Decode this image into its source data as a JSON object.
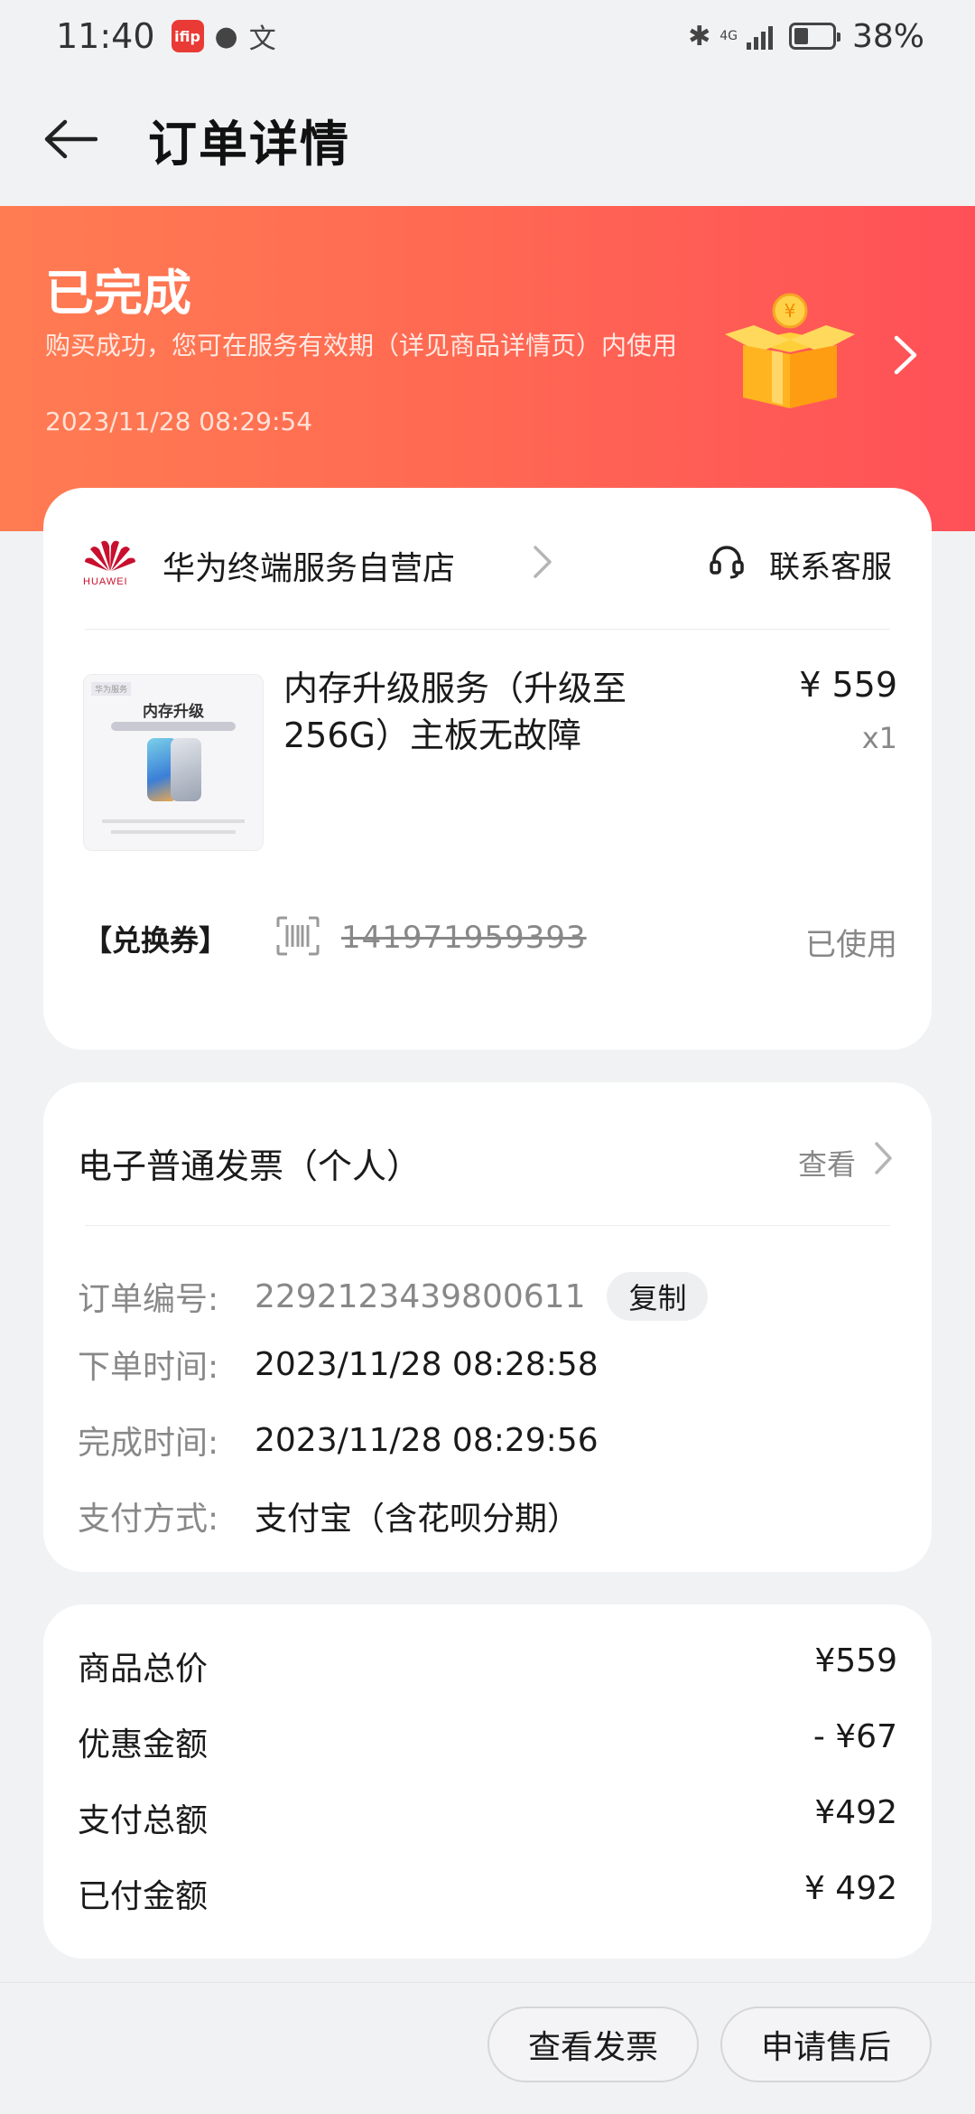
{
  "status_bar": {
    "time": "11:40",
    "app_badge": "ifip",
    "network": "4G",
    "battery_percent": "38%",
    "battery_level": 0.38
  },
  "header": {
    "title": "订单详情"
  },
  "banner": {
    "status": "已完成",
    "description": "购买成功，您可在服务有效期（详见商品详情页）内使用",
    "time": "2023/11/28 08:29:54",
    "gift_coin_symbol": "¥",
    "colors": {
      "start": "#ff7c52",
      "end": "#ff5058"
    }
  },
  "store": {
    "logo_text": "HUAWEI",
    "name": "华为终端服务自营店",
    "customer_service_label": "联系客服"
  },
  "product": {
    "image_tag": "华为服务",
    "image_title": "内存升级",
    "name": "内存升级服务（升级至256G）主板无故障",
    "price": "¥ 559",
    "quantity": "x1"
  },
  "voucher": {
    "label": "【兑换券】",
    "code": "141971959393",
    "status": "已使用"
  },
  "invoice": {
    "title": "电子普通发票（个人）",
    "view_label": "查看"
  },
  "order_info": {
    "order_no_label": "订单编号:",
    "order_no": "2292123439800611",
    "copy_label": "复制",
    "order_time_label": "下单时间:",
    "order_time": "2023/11/28 08:28:58",
    "complete_time_label": "完成时间:",
    "complete_time": "2023/11/28 08:29:56",
    "payment_label": "支付方式:",
    "payment": "支付宝（含花呗分期）"
  },
  "price_summary": {
    "rows": [
      {
        "label": "商品总价",
        "value": "¥559"
      },
      {
        "label": "优惠金额",
        "value": "- ¥67"
      },
      {
        "label": "支付总额",
        "value": "¥492"
      },
      {
        "label": "已付金额",
        "value": "¥ 492"
      }
    ]
  },
  "bottom_bar": {
    "view_invoice_label": "查看发票",
    "after_sale_label": "申请售后"
  }
}
